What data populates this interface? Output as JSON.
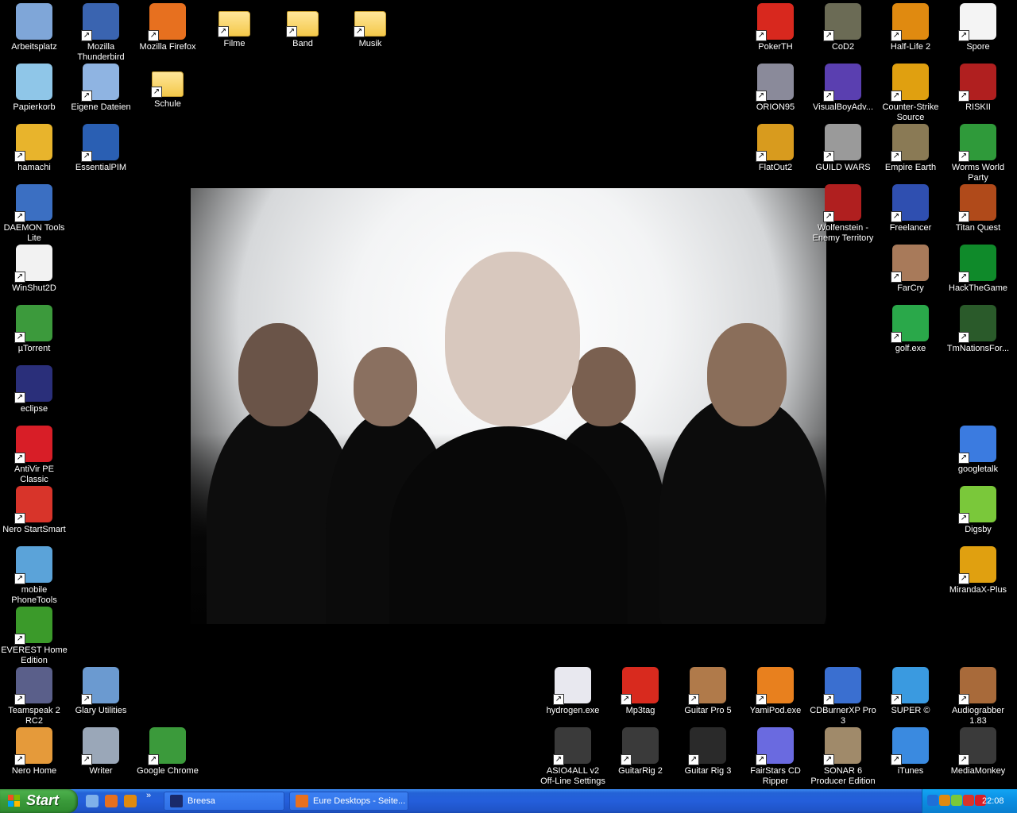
{
  "desktop_icons": [
    {
      "label": "Arbeitsplatz",
      "icon": "my-computer-icon",
      "color": "#7fa6d8"
    },
    {
      "label": "Mozilla Thunderbird",
      "icon": "thunderbird-icon",
      "color": "#3a64b0"
    },
    {
      "label": "Mozilla Firefox",
      "icon": "firefox-icon",
      "color": "#e7701f"
    },
    {
      "label": "Filme",
      "icon": "folder-icon",
      "color": "#f4c94a"
    },
    {
      "label": "Band",
      "icon": "folder-icon",
      "color": "#f4c94a"
    },
    {
      "label": "Musik",
      "icon": "folder-icon",
      "color": "#f4c94a"
    },
    {
      "label": "Papierkorb",
      "icon": "recycle-bin-icon",
      "color": "#8fc6e8"
    },
    {
      "label": "Eigene Dateien",
      "icon": "my-documents-icon",
      "color": "#8fb4e2"
    },
    {
      "label": "Schule",
      "icon": "folder-icon",
      "color": "#f4c94a"
    },
    {
      "label": "hamachi",
      "icon": "hamachi-icon",
      "color": "#e8b42c"
    },
    {
      "label": "EssentialPIM",
      "icon": "essentialpim-icon",
      "color": "#2a5fb3"
    },
    {
      "label": "DAEMON Tools Lite",
      "icon": "daemon-tools-icon",
      "color": "#3b6fc2"
    },
    {
      "label": "WinShut2D",
      "icon": "winshut-icon",
      "color": "#f2f2f2"
    },
    {
      "label": "µTorrent",
      "icon": "utorrent-icon",
      "color": "#3c9a3c"
    },
    {
      "label": "eclipse",
      "icon": "eclipse-icon",
      "color": "#2a2f7a"
    },
    {
      "label": "AntiVir PE Classic",
      "icon": "antivir-icon",
      "color": "#d81e27"
    },
    {
      "label": "Nero StartSmart",
      "icon": "nero-icon",
      "color": "#d8342a"
    },
    {
      "label": "mobile PhoneTools",
      "icon": "phonetools-icon",
      "color": "#5ba3d9"
    },
    {
      "label": "EVEREST Home Edition",
      "icon": "everest-icon",
      "color": "#3b9a2a"
    },
    {
      "label": "Teamspeak 2 RC2",
      "icon": "teamspeak-icon",
      "color": "#5a5f8a"
    },
    {
      "label": "Glary Utilities",
      "icon": "glary-icon",
      "color": "#6b9ad0"
    },
    {
      "label": "Nero Home",
      "icon": "nero-home-icon",
      "color": "#e59a3a"
    },
    {
      "label": "Writer",
      "icon": "writer-icon",
      "color": "#9aa7b8"
    },
    {
      "label": "Google Chrome",
      "icon": "chrome-icon",
      "color": "#3b9a3b"
    },
    {
      "label": "PokerTH",
      "icon": "pokerth-icon",
      "color": "#d8281e"
    },
    {
      "label": "CoD2",
      "icon": "cod2-icon",
      "color": "#6b6b55"
    },
    {
      "label": "Half-Life 2",
      "icon": "half-life-2-icon",
      "color": "#e08a10"
    },
    {
      "label": "Spore",
      "icon": "spore-icon",
      "color": "#f4f4f4"
    },
    {
      "label": "ORION95",
      "icon": "orion95-icon",
      "color": "#8a8a9a"
    },
    {
      "label": "VisualBoyAdv...",
      "icon": "visualboyadvance-icon",
      "color": "#5a3fb0"
    },
    {
      "label": "Counter-Strike Source",
      "icon": "counter-strike-icon",
      "color": "#e0a010"
    },
    {
      "label": "RISKII",
      "icon": "risk2-icon",
      "color": "#b01f1f"
    },
    {
      "label": "FlatOut2",
      "icon": "flatout2-icon",
      "color": "#d89b1e"
    },
    {
      "label": "GUILD WARS",
      "icon": "guild-wars-icon",
      "color": "#9a9a9a"
    },
    {
      "label": "Empire Earth",
      "icon": "empire-earth-icon",
      "color": "#8a7a55"
    },
    {
      "label": "Worms World Party",
      "icon": "worms-icon",
      "color": "#2f9a3a"
    },
    {
      "label": "Wolfenstein - Enemy Territory",
      "icon": "wolfenstein-icon",
      "color": "#b01f1f"
    },
    {
      "label": "Freelancer",
      "icon": "freelancer-icon",
      "color": "#2f4fb0"
    },
    {
      "label": "Titan Quest",
      "icon": "titan-quest-icon",
      "color": "#b04a1a"
    },
    {
      "label": "FarCry",
      "icon": "farcry-icon",
      "color": "#a87a5a"
    },
    {
      "label": "HackTheGame",
      "icon": "hackthegame-icon",
      "color": "#0f8a2a"
    },
    {
      "label": "golf.exe",
      "icon": "golf-icon",
      "color": "#2aa84a"
    },
    {
      "label": "TmNationsFor...",
      "icon": "trackmania-icon",
      "color": "#2a5a2a"
    },
    {
      "label": "googletalk",
      "icon": "googletalk-icon",
      "color": "#3b7be0"
    },
    {
      "label": "Digsby",
      "icon": "digsby-icon",
      "color": "#7ac83a"
    },
    {
      "label": "MirandaX-Plus",
      "icon": "miranda-icon",
      "color": "#e0a010"
    },
    {
      "label": "hydrogen.exe",
      "icon": "hydrogen-icon",
      "color": "#e8e8ef"
    },
    {
      "label": "Mp3tag",
      "icon": "mp3tag-icon",
      "color": "#d82a1e"
    },
    {
      "label": "Guitar Pro 5",
      "icon": "guitar-pro-icon",
      "color": "#b07a4a"
    },
    {
      "label": "YamiPod.exe",
      "icon": "yamipod-icon",
      "color": "#e8801e"
    },
    {
      "label": "CDBurnerXP Pro 3",
      "icon": "cdburnerxp-icon",
      "color": "#3a6fd0"
    },
    {
      "label": "SUPER ©",
      "icon": "super-icon",
      "color": "#3a9ae0"
    },
    {
      "label": "Audiograbber 1.83",
      "icon": "audiograbber-icon",
      "color": "#a86a3a"
    },
    {
      "label": "ASIO4ALL v2 Off-Line Settings",
      "icon": "asio4all-icon",
      "color": "#3a3a3a"
    },
    {
      "label": "GuitarRig 2",
      "icon": "guitarrig-icon",
      "color": "#3a3a3a"
    },
    {
      "label": "Guitar Rig 3",
      "icon": "guitarrig3-icon",
      "color": "#2a2a2a"
    },
    {
      "label": "FairStars CD Ripper",
      "icon": "fairstars-icon",
      "color": "#6a6ae0"
    },
    {
      "label": "SONAR 6 Producer Edition",
      "icon": "sonar-icon",
      "color": "#a08a6a"
    },
    {
      "label": "iTunes",
      "icon": "itunes-icon",
      "color": "#3a8ae0"
    },
    {
      "label": "MediaMonkey",
      "icon": "mediamonkey-icon",
      "color": "#3a3a3a"
    }
  ],
  "taskbar": {
    "start_label": "Start",
    "quick_launch": [
      {
        "icon": "show-desktop-icon",
        "color": "#7fb0ea"
      },
      {
        "icon": "firefox-icon",
        "color": "#e7701f"
      },
      {
        "icon": "half-life-2-icon",
        "color": "#e08a10"
      }
    ],
    "more": "»",
    "tasks": [
      {
        "label": "Breesa",
        "icon": "window-icon",
        "color": "#1a2a6a"
      },
      {
        "label": "Eure Desktops - Seite...",
        "icon": "firefox-icon",
        "color": "#e7701f"
      }
    ],
    "tray_icons": [
      {
        "icon": "tray-arrow-icon",
        "color": "#1e6fd8"
      },
      {
        "icon": "tray-hl2-icon",
        "color": "#e08a10"
      },
      {
        "icon": "tray-digsby-icon",
        "color": "#7ac83a"
      },
      {
        "icon": "tray-nero-icon",
        "color": "#d8342a"
      },
      {
        "icon": "tray-antivir-icon",
        "color": "#d81e27"
      }
    ],
    "clock": "22:08"
  }
}
